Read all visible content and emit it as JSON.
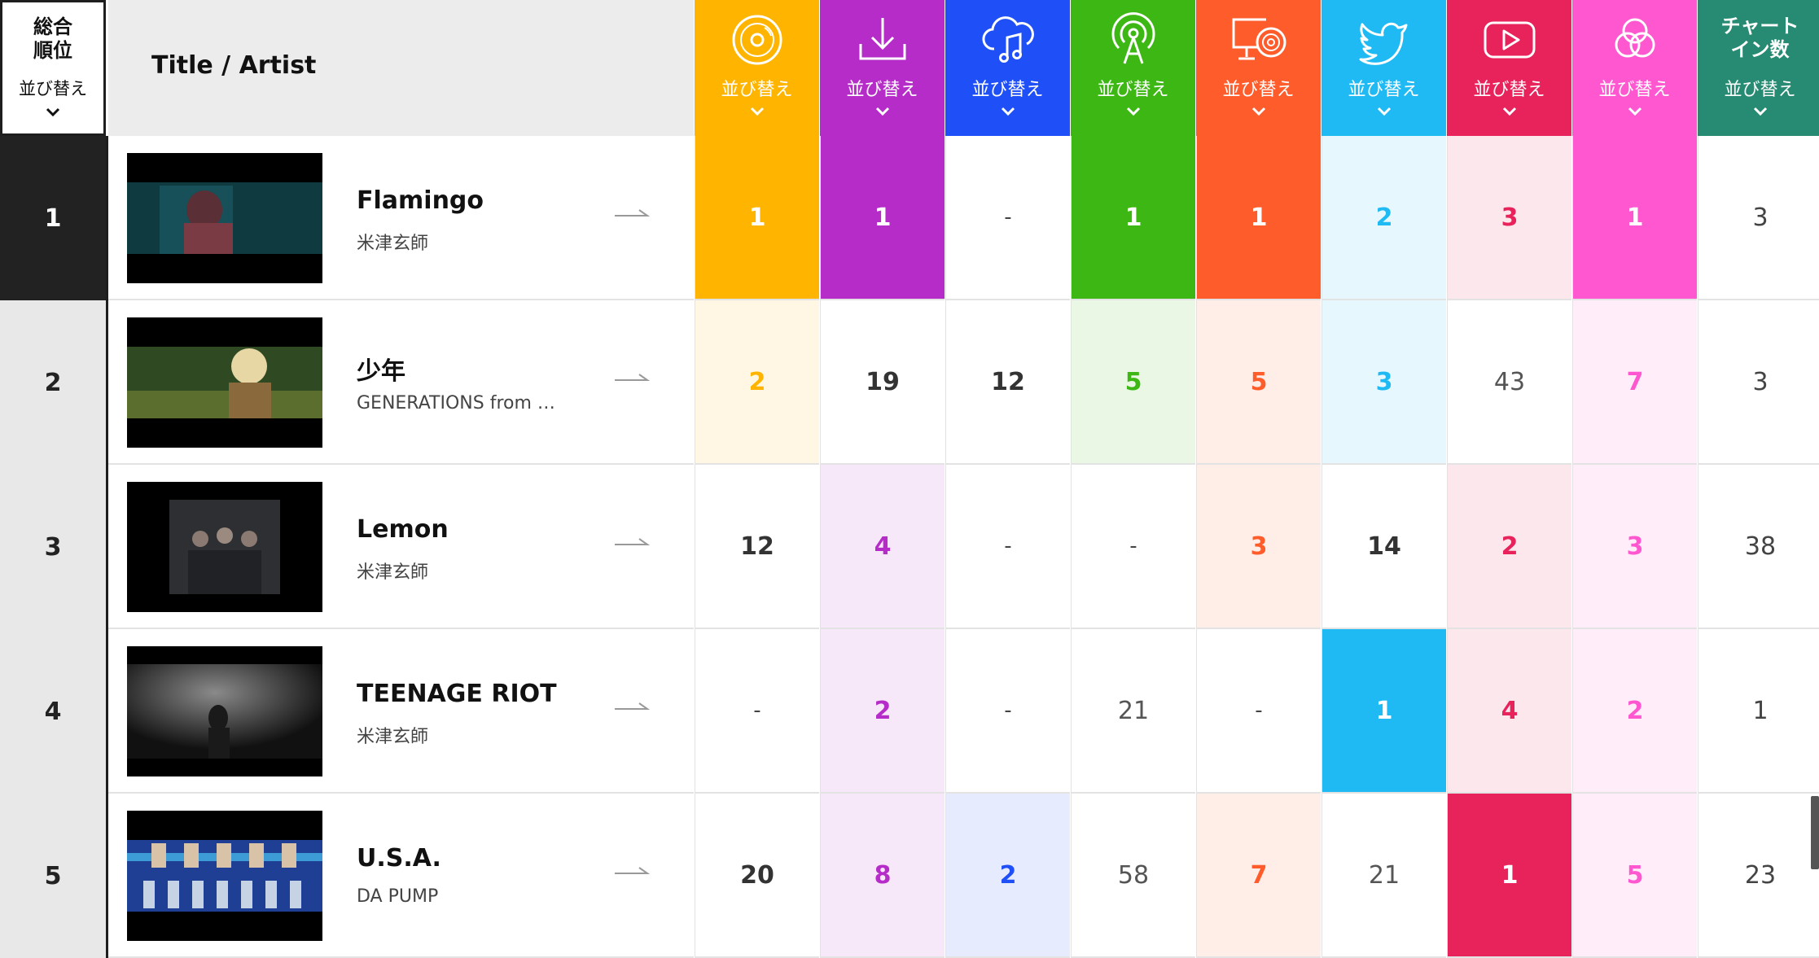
{
  "header": {
    "rank_label_line1": "総合",
    "rank_label_line2": "順位",
    "sort_label": "並び替え",
    "title_artist_label": "Title / Artist",
    "columns": [
      {
        "name": "physical-cd",
        "icon": "cd-icon",
        "color": "#ffb400",
        "sort_label": "並び替え"
      },
      {
        "name": "download",
        "icon": "download-icon",
        "color": "#b52cc8",
        "sort_label": "並び替え"
      },
      {
        "name": "streaming",
        "icon": "cloud-music-icon",
        "color": "#1f4ff7",
        "sort_label": "並び替え"
      },
      {
        "name": "radio",
        "icon": "radio-tower-icon",
        "color": "#3db713",
        "sort_label": "並び替え"
      },
      {
        "name": "pc-lookup",
        "icon": "monitor-cd-icon",
        "color": "#ff5c2b",
        "sort_label": "並び替え"
      },
      {
        "name": "twitter",
        "icon": "twitter-icon",
        "color": "#1fbaf3",
        "sort_label": "並び替え"
      },
      {
        "name": "youtube",
        "icon": "youtube-icon",
        "color": "#e8225a",
        "sort_label": "並び替え"
      },
      {
        "name": "gyao",
        "icon": "three-circles-icon",
        "color": "#ff57cf",
        "sort_label": "並び替え"
      },
      {
        "name": "chart-in-count",
        "label_line1": "チャート",
        "label_line2": "イン数",
        "color": "#278a72",
        "sort_label": "並び替え"
      }
    ]
  },
  "rows": [
    {
      "rank": "1",
      "title": "Flamingo",
      "artist": "米津玄師",
      "cells": [
        "1",
        "1",
        "-",
        "1",
        "1",
        "2",
        "3",
        "1",
        "3"
      ]
    },
    {
      "rank": "2",
      "title": "少年",
      "artist": "GENERATIONS from …",
      "cells": [
        "2",
        "19",
        "12",
        "5",
        "5",
        "3",
        "43",
        "7",
        "3"
      ]
    },
    {
      "rank": "3",
      "title": "Lemon",
      "artist": "米津玄師",
      "cells": [
        "12",
        "4",
        "-",
        "-",
        "3",
        "14",
        "2",
        "3",
        "38"
      ]
    },
    {
      "rank": "4",
      "title": "TEENAGE RIOT",
      "artist": "米津玄師",
      "cells": [
        "-",
        "2",
        "-",
        "21",
        "-",
        "1",
        "4",
        "2",
        "1"
      ]
    },
    {
      "rank": "5",
      "title": "U.S.A.",
      "artist": "DA PUMP",
      "cells": [
        "20",
        "8",
        "2",
        "58",
        "7",
        "21",
        "1",
        "5",
        "23"
      ]
    }
  ]
}
